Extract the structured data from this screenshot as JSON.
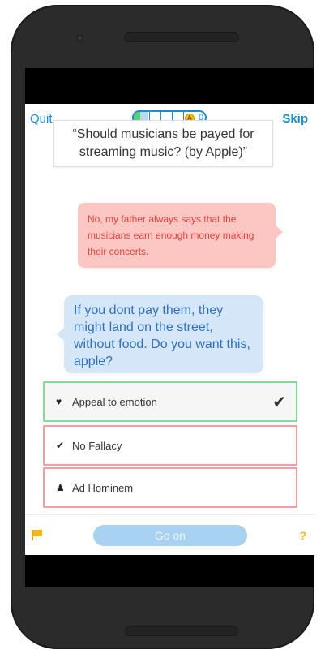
{
  "header": {
    "quit_label": "Quit",
    "skip_label": "Skip",
    "coin_symbol": "A",
    "coin_count": "0",
    "progress": 0.2
  },
  "question": {
    "text": "“Should musicians be payed for streaming music? (by Apple)”"
  },
  "bubbles": {
    "opponent": "No, my father always says that the musicians earn enough money making their concerts.",
    "apple": "If you dont pay them, they might land on the street, without food. Do you want this, apple?"
  },
  "options": [
    {
      "label": "Appeal to emotion",
      "icon": "heart-icon",
      "glyph": "♥",
      "state": "correct",
      "check": "✔"
    },
    {
      "label": "No Fallacy",
      "icon": "check-icon",
      "glyph": "✔",
      "state": "wrong"
    },
    {
      "label": "Ad Hominem",
      "icon": "person-icon",
      "glyph": "♟",
      "state": "wrong"
    }
  ],
  "footer": {
    "go_on_label": "Go on",
    "help_label": "?",
    "flag_icon": "flag-icon"
  },
  "colors": {
    "accent": "#1a8ccc",
    "correct_border": "#7ddc95",
    "wrong_border": "#f09ca0",
    "opponent_bubble": "#fcc7c2",
    "opponent_text": "#e2413e",
    "apple_bubble": "#d4e6f8",
    "apple_text": "#2f6fb9",
    "button": "#a9d2f2",
    "flag": "#f2b81a"
  }
}
